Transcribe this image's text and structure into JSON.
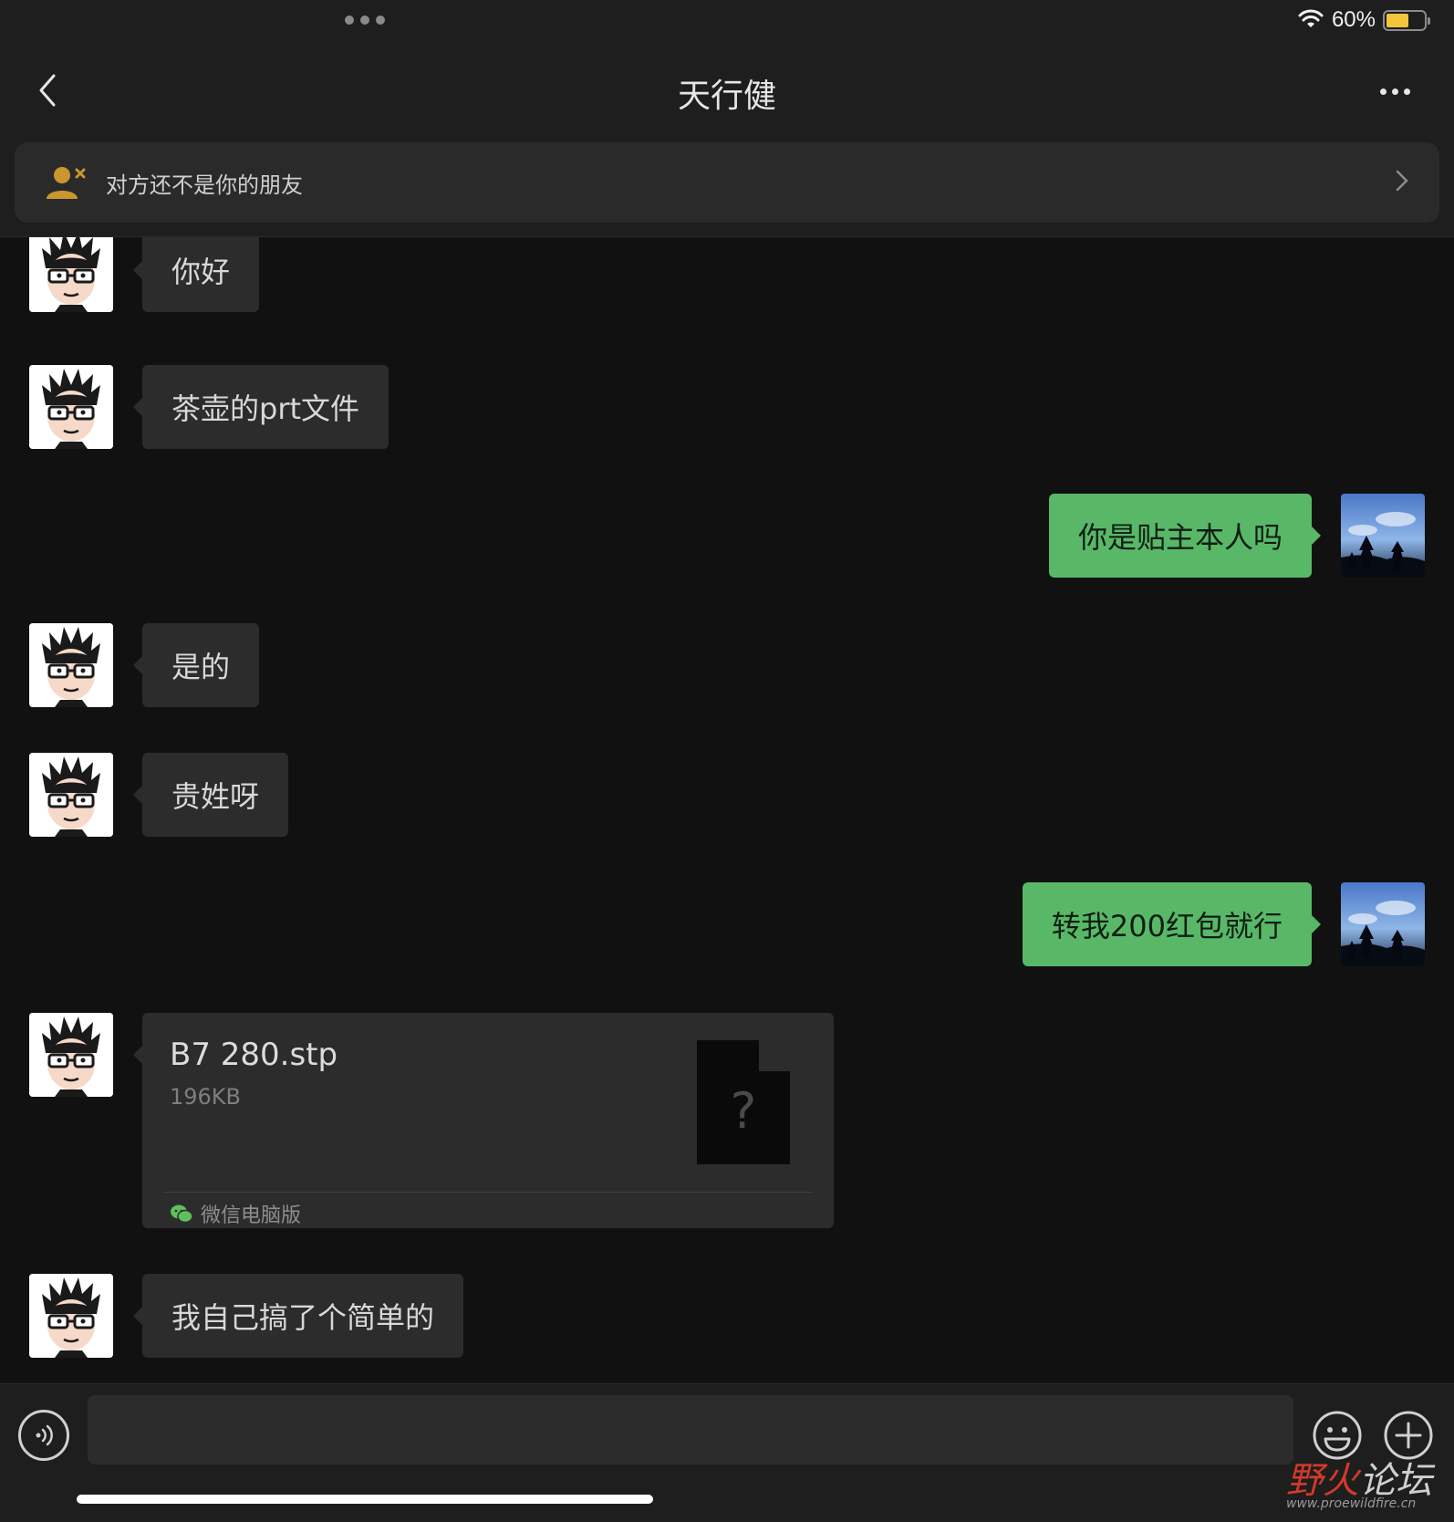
{
  "status_bar": {
    "battery_percent": "60%",
    "battery_level": 0.6
  },
  "header": {
    "title": "天行健"
  },
  "banner": {
    "text": "对方还不是你的朋友"
  },
  "messages": [
    {
      "side": "left",
      "text": "你好"
    },
    {
      "side": "left",
      "text": "茶壶的prt文件"
    },
    {
      "side": "right",
      "text": "你是贴主本人吗"
    },
    {
      "side": "left",
      "text": "是的"
    },
    {
      "side": "left",
      "text": "贵姓呀"
    },
    {
      "side": "right",
      "text": "转我200红包就行"
    },
    {
      "side": "left",
      "type": "file",
      "file_name": "B7 280.stp",
      "file_size": "196KB",
      "file_icon_glyph": "?",
      "source": "微信电脑版"
    },
    {
      "side": "left",
      "text": "我自己搞了个简单的"
    }
  ],
  "input": {
    "value": "",
    "placeholder": ""
  },
  "watermark": {
    "text_red": "野火",
    "text_dark": "论坛",
    "url": "www.proewildfire.cn"
  },
  "colors": {
    "bg": "#111111",
    "bar": "#1e1e1e",
    "bubble_in": "#2c2c2c",
    "bubble_out": "#58b868",
    "battery": "#f2c53d"
  },
  "icons": [
    "back-chevron-icon",
    "more-icon",
    "not-friend-icon",
    "chevron-right-icon",
    "wifi-icon",
    "battery-icon",
    "voice-icon",
    "emoji-icon",
    "plus-icon",
    "wechat-icon",
    "unknown-file-icon"
  ]
}
